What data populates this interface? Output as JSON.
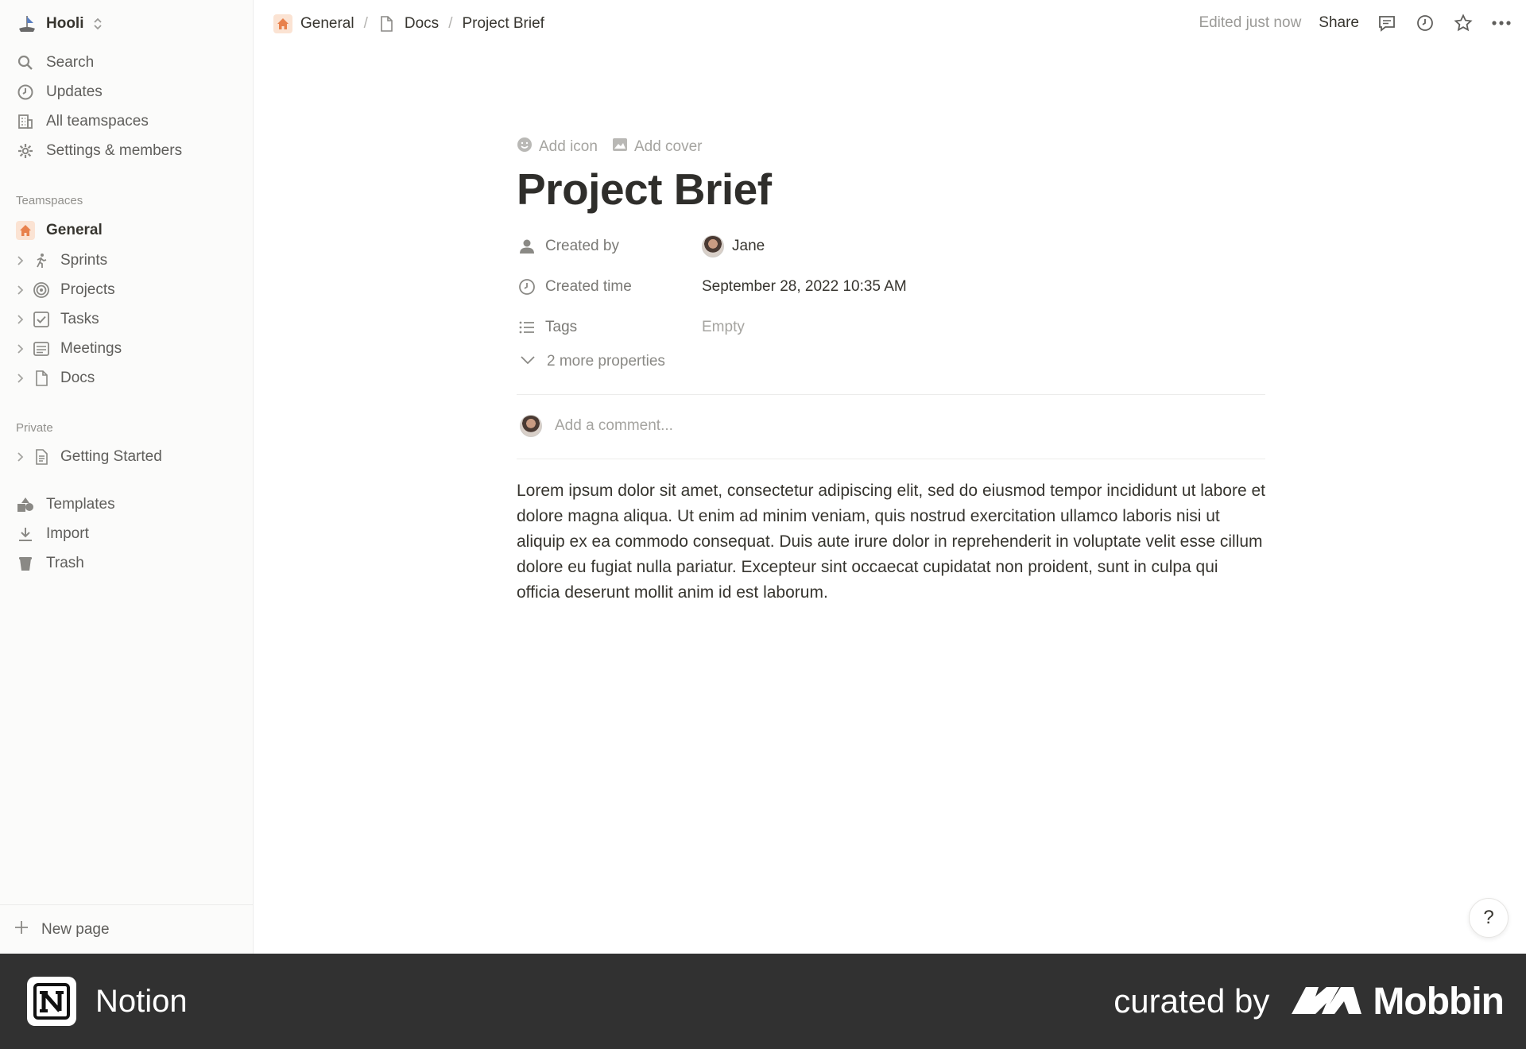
{
  "workspace": {
    "name": "Hooli"
  },
  "sidebar": {
    "nav": [
      {
        "label": "Search",
        "icon": "search-icon"
      },
      {
        "label": "Updates",
        "icon": "clock-icon"
      },
      {
        "label": "All teamspaces",
        "icon": "building-icon"
      },
      {
        "label": "Settings & members",
        "icon": "gear-icon"
      }
    ],
    "teamspaces_heading": "Teamspaces",
    "teamspaces": [
      {
        "label": "General",
        "icon": "home-icon"
      },
      {
        "label": "Sprints",
        "icon": "runner-icon"
      },
      {
        "label": "Projects",
        "icon": "target-icon"
      },
      {
        "label": "Tasks",
        "icon": "checkbox-icon"
      },
      {
        "label": "Meetings",
        "icon": "notes-icon"
      },
      {
        "label": "Docs",
        "icon": "page-icon"
      }
    ],
    "private_heading": "Private",
    "private": [
      {
        "label": "Getting Started",
        "icon": "document-icon"
      }
    ],
    "tools": [
      {
        "label": "Templates",
        "icon": "templates-icon"
      },
      {
        "label": "Import",
        "icon": "download-icon"
      },
      {
        "label": "Trash",
        "icon": "trash-icon"
      }
    ],
    "new_page": "New page"
  },
  "topbar": {
    "breadcrumb": [
      "General",
      "Docs",
      "Project Brief"
    ],
    "edited": "Edited just now",
    "share": "Share"
  },
  "page": {
    "add_icon": "Add icon",
    "add_cover": "Add cover",
    "title": "Project Brief",
    "properties": [
      {
        "name": "Created by",
        "value": "Jane"
      },
      {
        "name": "Created time",
        "value": "September 28, 2022 10:35 AM"
      },
      {
        "name": "Tags",
        "value": "Empty"
      }
    ],
    "more_properties": "2 more properties",
    "comment_placeholder": "Add a comment...",
    "body": "Lorem ipsum dolor sit amet, consectetur adipiscing elit, sed do eiusmod tempor incididunt ut labore et dolore magna aliqua. Ut enim ad minim veniam, quis nostrud exercitation ullamco laboris nisi ut aliquip ex ea commodo consequat. Duis aute irure dolor in reprehenderit in voluptate velit esse cillum dolore eu fugiat nulla pariatur. Excepteur sint occaecat cupidatat non proident, sunt in culpa qui officia deserunt mollit anim id est laborum.",
    "help": "?"
  },
  "banner": {
    "app": "Notion",
    "curated": "curated by",
    "brand": "Mobbin"
  },
  "colors": {
    "accent": "#e8814c",
    "sidebar_bg": "#fbfbfa",
    "banner_bg": "#313131"
  }
}
